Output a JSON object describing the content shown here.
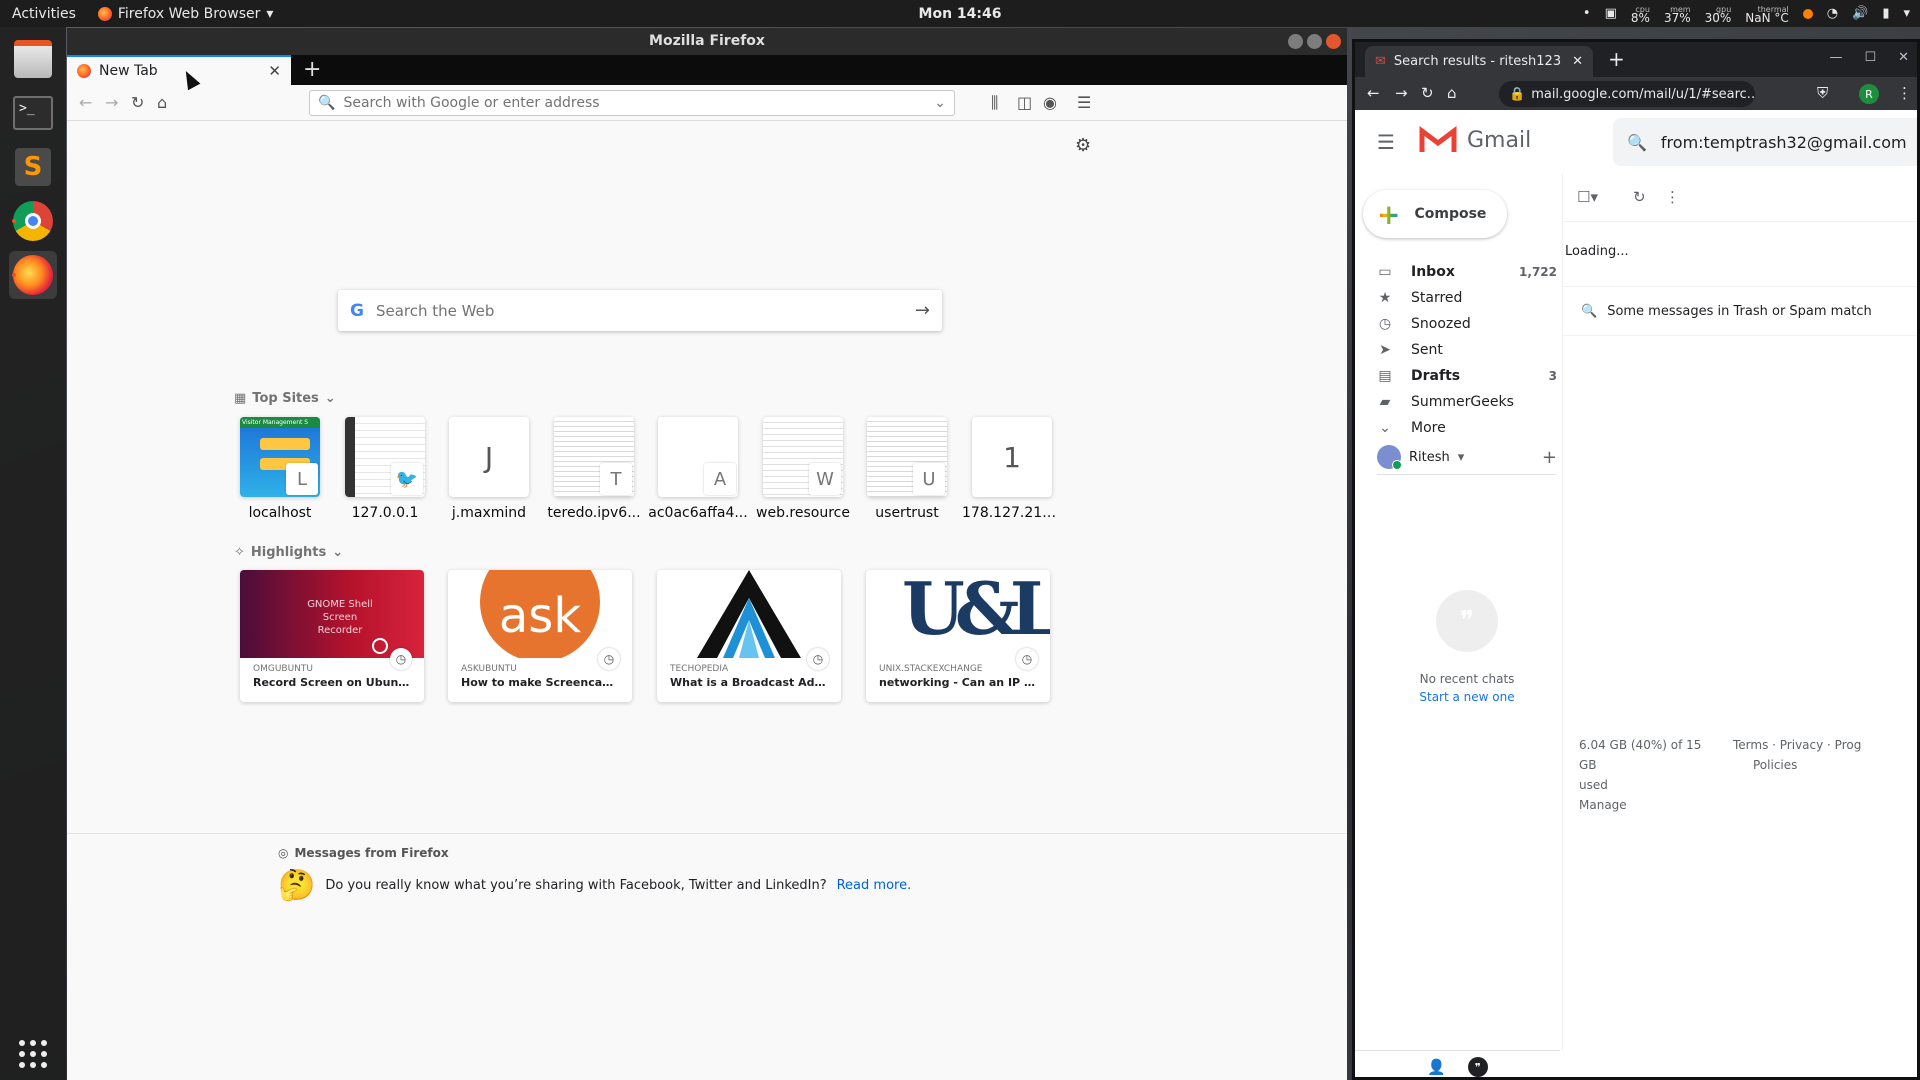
{
  "topbar": {
    "activities": "Activities",
    "app_menu": "Firefox Web Browser",
    "clock": "Mon 14:46",
    "cpu_label": "cpu",
    "cpu_val": "8%",
    "mem_label": "mem",
    "mem_val": "37%",
    "gpu_label": "gpu",
    "gpu_val": "30%",
    "thermal_label": "thermal",
    "thermal_val": "NaN °C"
  },
  "dock": {
    "items": [
      "files-app-icon",
      "terminal-app-icon",
      "sublime-text-app-icon",
      "chrome-app-icon",
      "firefox-app-icon"
    ],
    "show_apps_icon": "grid-icon"
  },
  "firefox": {
    "window_title": "Mozilla Firefox",
    "tab_title": "New Tab",
    "url_placeholder": "Search with Google or enter address",
    "web_search_placeholder": "Search the Web",
    "top_sites_title": "Top Sites",
    "top_sites": [
      {
        "label": "localhost",
        "badge": "L"
      },
      {
        "label": "127.0.0.1",
        "badge": ""
      },
      {
        "label": "j.maxmind",
        "badge": "J"
      },
      {
        "label": "teredo.ipv6...",
        "badge": "T"
      },
      {
        "label": "ac0ac6affa4...",
        "badge": "A"
      },
      {
        "label": "web.resource",
        "badge": "W"
      },
      {
        "label": "usertrust",
        "badge": "U"
      },
      {
        "label": "178.127.215...",
        "badge": "1"
      }
    ],
    "localhost_thumb_text": "Visitor Management S",
    "highlights_title": "Highlights",
    "highlights": [
      {
        "source": "OMGUBUNTU",
        "title": "Record Screen on Ubuntu Using ...",
        "image_text": "GNOME Shell Screen Recorder"
      },
      {
        "source": "ASKUBUNTU",
        "title": "How to make Screencast on Ub...",
        "image_text": "ask"
      },
      {
        "source": "TECHOPEDIA",
        "title": "What is a Broadcast Address? - ...",
        "image_text": ""
      },
      {
        "source": "UNIX.STACKEXCHANGE",
        "title": "networking - Can an IP address ...",
        "image_text": "U&L"
      }
    ],
    "messages_title": "Messages from Firefox",
    "message_text": "Do you really know what you’re sharing with Facebook, Twitter and LinkedIn?",
    "message_link": "Read more."
  },
  "chrome": {
    "tab_title": "Search results - ritesh123",
    "url": "mail.google.com/mail/u/1/#searc...",
    "profile_initial": "R"
  },
  "gmail": {
    "logo_text": "Gmail",
    "search_query": "from:temptrash32@gmail.com",
    "compose_label": "Compose",
    "nav": [
      {
        "label": "Inbox",
        "count": "1,722",
        "icon": "inbox-icon",
        "bold": true
      },
      {
        "label": "Starred",
        "count": "",
        "icon": "star-icon",
        "bold": false
      },
      {
        "label": "Snoozed",
        "count": "",
        "icon": "clock-icon",
        "bold": false
      },
      {
        "label": "Sent",
        "count": "",
        "icon": "send-icon",
        "bold": false
      },
      {
        "label": "Drafts",
        "count": "3",
        "icon": "draft-icon",
        "bold": true
      },
      {
        "label": "SummerGeeks",
        "count": "",
        "icon": "label-icon",
        "bold": false
      },
      {
        "label": "More",
        "count": "",
        "icon": "chevron-down-icon",
        "bold": false
      }
    ],
    "hangouts_user": "Ritesh",
    "no_recent_chats": "No recent chats",
    "start_new": "Start a new one",
    "loading": "Loading...",
    "trash_message": "Some messages in Trash or Spam match",
    "storage_line1": "6.04 GB (40%) of 15 GB",
    "storage_line2": "used",
    "manage": "Manage",
    "footer_terms": "Terms · Privacy · Prog",
    "footer_policies": "Policies"
  },
  "colors": {
    "ubuntu_orange": "#e95420",
    "firefox_blue": "#0a84ff",
    "gmail_red": "#ea4335",
    "askubuntu_orange": "#e7742e"
  }
}
